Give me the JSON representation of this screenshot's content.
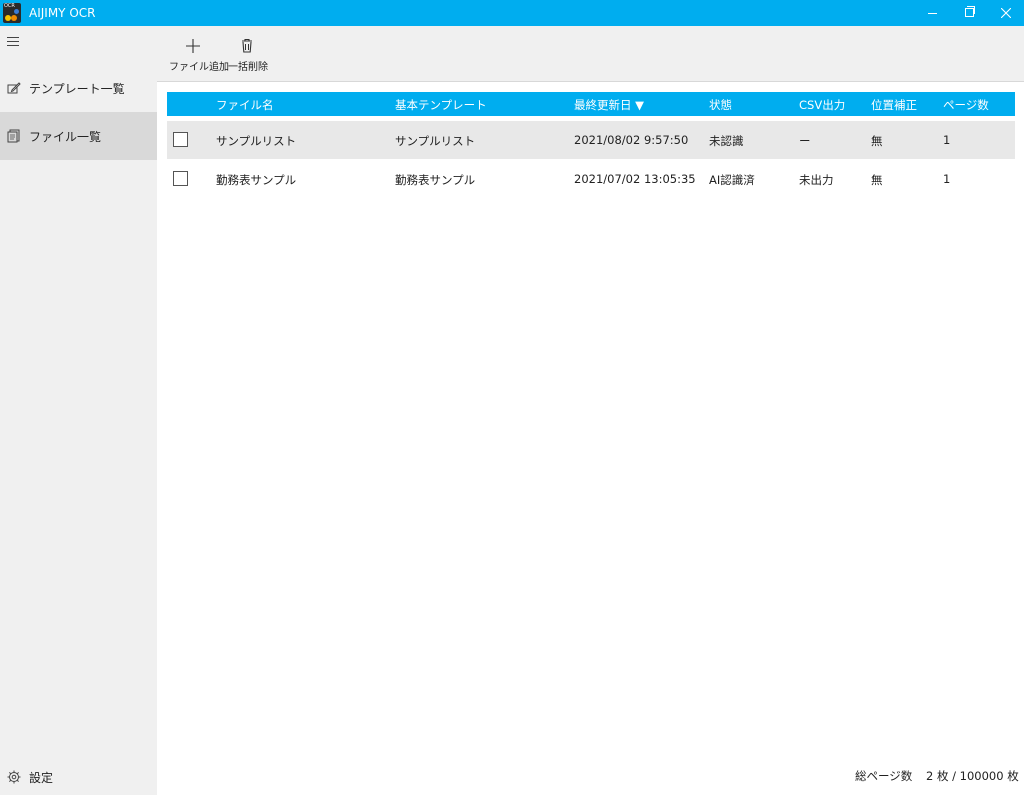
{
  "window": {
    "title": "AIJIMY OCR",
    "icon_text": "OCR",
    "accent_color": "#00adef"
  },
  "sidebar": {
    "menu_icon": "hamburger-icon",
    "items": [
      {
        "label": "テンプレート一覧",
        "icon": "edit-icon",
        "selected": false
      },
      {
        "label": "ファイル一覧",
        "icon": "document-icon",
        "selected": true
      }
    ],
    "settings_label": "設定",
    "settings_icon": "gear-icon"
  },
  "toolbar": {
    "add_label": "ファイル追加",
    "add_icon": "plus-icon",
    "delete_label": "一括削除",
    "delete_icon": "trash-icon"
  },
  "table": {
    "columns": [
      "ファイル名",
      "基本テンプレート",
      "最終更新日 ▼",
      "状態",
      "CSV出力",
      "位置補正",
      "ページ数"
    ],
    "rows": [
      {
        "file": "サンプルリスト",
        "template": "サンプルリスト",
        "updated": "2021/08/02 9:57:50",
        "status": "未認識",
        "csv": "ー",
        "position": "無",
        "pages": "1",
        "checked": false
      },
      {
        "file": "勤務表サンプル",
        "template": "勤務表サンプル",
        "updated": "2021/07/02 13:05:35",
        "status": "AI認識済",
        "csv": "未出力",
        "position": "無",
        "pages": "1",
        "checked": false
      }
    ]
  },
  "footer": {
    "total_label": "総ページ数",
    "total_value": "2 枚 / 100000 枚"
  }
}
